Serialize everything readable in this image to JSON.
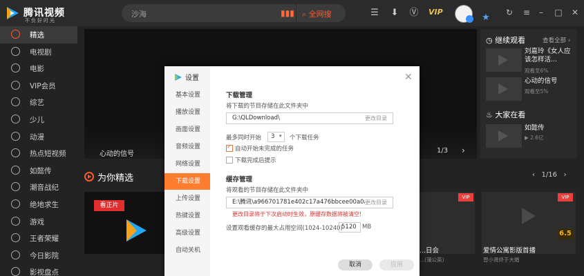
{
  "app": {
    "logo_text": "腾讯视频",
    "logo_sub": "不负好时光"
  },
  "search": {
    "query": "沙海",
    "button_label": "全网搜"
  },
  "header": {
    "vip_label": "VIP"
  },
  "sidebar": {
    "items": [
      {
        "label": "精选",
        "icon": "featured-icon"
      },
      {
        "label": "电视剧",
        "icon": "tv-icon"
      },
      {
        "label": "电影",
        "icon": "movie-icon"
      },
      {
        "label": "VIP会员",
        "icon": "vip-icon"
      },
      {
        "label": "综艺",
        "icon": "variety-icon"
      },
      {
        "label": "少儿",
        "icon": "kids-icon"
      },
      {
        "label": "动漫",
        "icon": "anime-icon"
      },
      {
        "label": "热点短视频",
        "icon": "shortvideo-icon"
      },
      {
        "label": "如懿传",
        "icon": "drama-icon"
      },
      {
        "label": "潮音战纪",
        "icon": "music-icon"
      },
      {
        "label": "绝地求生",
        "icon": "game-icon"
      },
      {
        "label": "游戏",
        "icon": "games-icon"
      },
      {
        "label": "王者荣耀",
        "icon": "honor-icon"
      },
      {
        "label": "今日影院",
        "icon": "cinema-icon"
      },
      {
        "label": "影视盘点",
        "icon": "review-icon"
      }
    ]
  },
  "banner": {
    "title": "心动的信号",
    "pager": "1/3"
  },
  "right_panel": {
    "continue_title": "继续观看",
    "view_all": "查看全部",
    "continue_items": [
      {
        "name": "刘嘉玲《女人应该怎样活...",
        "progress_text": "观看至6%"
      },
      {
        "name": "心动的信号",
        "progress_text": "观看至5%"
      }
    ],
    "popular_title": "大家在看",
    "popular_items": [
      {
        "name": "如懿传",
        "views": "2.6亿"
      }
    ]
  },
  "section": {
    "title": "为你精选",
    "pager": "1/16",
    "cards": [
      {
        "badge": "看正片"
      },
      {
        "title": "...日会",
        "sub": "...(蒲公英)",
        "vip": "VIP"
      },
      {
        "title": "爱情公寓影版首播",
        "sub": "曾小贤终于大婚",
        "vip": "VIP",
        "score": "6.5"
      }
    ]
  },
  "dialog": {
    "title": "设置",
    "nav": [
      "基本设置",
      "播放设置",
      "画面设置",
      "音频设置",
      "网络设置",
      "下载设置",
      "上传设置",
      "热键设置",
      "高级设置",
      "自动关机"
    ],
    "active_nav_index": 5,
    "download": {
      "heading": "下载管理",
      "desc": "将下载的节目存储在此文件夹中",
      "path": "G:\\QLDownload\\",
      "change_btn": "更改目录",
      "concurrent_prefix": "最多同时开始",
      "concurrent_value": "3",
      "concurrent_suffix": "个下载任务",
      "auto_start_label": "自动开始未完成的任务",
      "auto_start_checked": true,
      "notify_label": "下载完成后提示",
      "notify_checked": false
    },
    "cache": {
      "heading": "缓存管理",
      "desc": "将观看的节目存储在此文件夹中",
      "path": "E:\\腾讯\\a966701781e402c17a476bbcee00a0a0\\",
      "change_btn": "更改目录",
      "warning": "更改目录将于下次启动时生效，原缓存数据将被清空!",
      "max_label": "设置观看缓存的最大占用空间(1024-10240)",
      "max_value": "5120",
      "unit": "MB"
    },
    "buttons": {
      "cancel": "取消",
      "apply": "应用"
    }
  }
}
